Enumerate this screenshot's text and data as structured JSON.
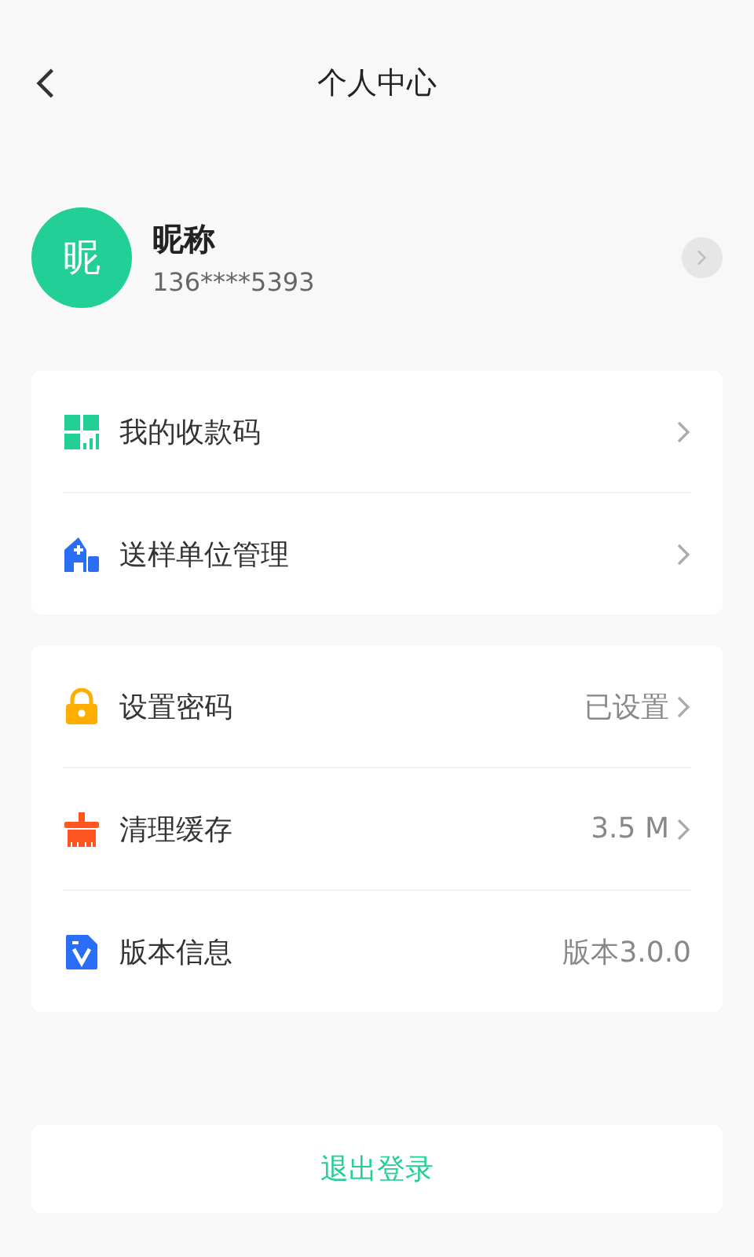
{
  "nav": {
    "title": "个人中心"
  },
  "profile": {
    "avatar": "昵",
    "name": "昵称",
    "phone": "136****5393"
  },
  "groups": [
    {
      "rows": [
        {
          "kind": "qrcode",
          "label": "我的收款码",
          "arrow": true
        },
        {
          "kind": "building",
          "label": "送样单位管理",
          "arrow": true
        }
      ]
    },
    {
      "rows": [
        {
          "kind": "lock",
          "label": "设置密码",
          "value": "已设置",
          "arrow": true
        },
        {
          "kind": "broom",
          "label": "清理缓存",
          "value": "3.5 M",
          "arrow": true
        },
        {
          "kind": "version",
          "label": "版本信息",
          "value": "版本3.0.0",
          "arrow": false
        }
      ]
    }
  ],
  "logout": "退出登录"
}
